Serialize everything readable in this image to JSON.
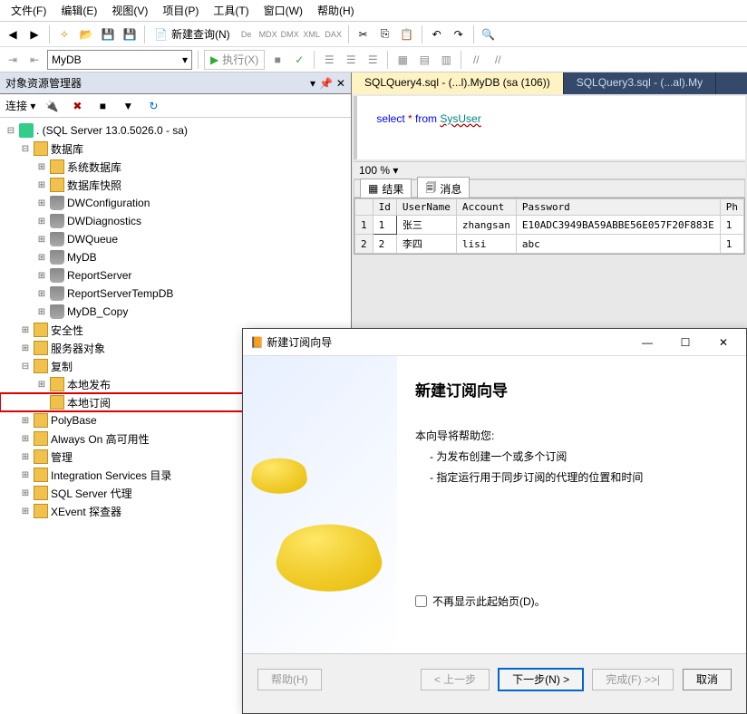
{
  "menu": [
    "文件(F)",
    "编辑(E)",
    "视图(V)",
    "项目(P)",
    "工具(T)",
    "窗口(W)",
    "帮助(H)"
  ],
  "toolbar": {
    "new_query": "新建查询(N)"
  },
  "exec": {
    "db": "MyDB",
    "execute": "执行(X)"
  },
  "sidebar": {
    "title": "对象资源管理器",
    "connect": "连接",
    "root": ". (SQL Server 13.0.5026.0 - sa)",
    "databases": "数据库",
    "sysdb": "系统数据库",
    "snapshot": "数据库快照",
    "dbs": [
      "DWConfiguration",
      "DWDiagnostics",
      "DWQueue",
      "MyDB",
      "ReportServer",
      "ReportServerTempDB",
      "MyDB_Copy"
    ],
    "security": "安全性",
    "serverobj": "服务器对象",
    "replication": "复制",
    "localpub": "本地发布",
    "localsub": "本地订阅",
    "polybase": "PolyBase",
    "alwayson": "Always On 高可用性",
    "mgmt": "管理",
    "intsvc": "Integration Services 目录",
    "agent": "SQL Server 代理",
    "xevent": "XEvent 探查器"
  },
  "editor": {
    "tabs": [
      "SQLQuery4.sql - (...l).MyDB (sa (106))",
      "SQLQuery3.sql - (...al).My"
    ],
    "sql": "select * from SysUser",
    "zoom": "100 %",
    "results": "结果",
    "messages": "消息",
    "cols": [
      "",
      "Id",
      "UserName",
      "Account",
      "Password",
      "Ph"
    ],
    "rows": [
      {
        "n": "1",
        "id": "1",
        "user": "张三",
        "acct": "zhangsan",
        "pwd": "E10ADC3949BA59ABBE56E057F20F883E",
        "ph": "1"
      },
      {
        "n": "2",
        "id": "2",
        "user": "李四",
        "acct": "lisi",
        "pwd": "abc",
        "ph": "1"
      }
    ]
  },
  "wizard": {
    "title": "新建订阅向导",
    "heading": "新建订阅向导",
    "intro": "本向导将帮助您:",
    "b1": "- 为发布创建一个或多个订阅",
    "b2": "- 指定运行用于同步订阅的代理的位置和时间",
    "noshow": "不再显示此起始页(D)。",
    "help": "帮助(H)",
    "back": "< 上一步",
    "next": "下一步(N) >",
    "finish": "完成(F) >>|",
    "cancel": "取消"
  }
}
